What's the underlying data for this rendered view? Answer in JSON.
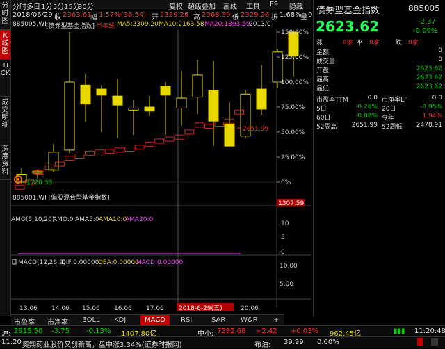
{
  "side_nav": [
    "分时图",
    "K线图",
    "TICK",
    "成交明细",
    "深度资料"
  ],
  "top_menu": [
    "分时",
    "多日",
    "1分",
    "5分",
    "15分",
    "30分",
    "复权",
    "超级叠加",
    "画线",
    "工具",
    "F9",
    "隐藏"
  ],
  "info_bar": {
    "date": "2018/06/29",
    "close_label": "收",
    "close": "2363.61",
    "pct_label": "幅",
    "pct": "1.57%(36.54)",
    "open_label": "开",
    "open": "2329.26",
    "high_label": "高",
    "high": "2368.30",
    "low_label": "低",
    "low": "2329.26",
    "amp_label": "振",
    "amp": "1.68%",
    "vol_label": "量",
    "vol": "0"
  },
  "ma_bar": {
    "code": "885005.WI",
    "name": "[债券型基金指数]",
    "half_year": "半年线",
    "ma5": "MA5:2309.20",
    "ma10": "MA10:2163.58",
    "ma20": "MA20:1893.59",
    "date": "2013/0"
  },
  "price_axis": [
    "150.00%",
    "125.00%",
    "100.00%",
    "75.00%",
    "50.00%",
    "25.00%",
    "0%"
  ],
  "overlay": {
    "label": "885001.WI [偏股混合型基金指数]",
    "base_value": "1720.33",
    "peak_value": "2651.99",
    "right_value": "1307.59"
  },
  "amo_bar": {
    "title": "AMO(5,10,20)",
    "amo": "AMO:0",
    "amo5": "AMA5:0",
    "amo10": "AMA10:0",
    "amo20": "AMA20:0"
  },
  "amo_axis": [
    "10",
    "5",
    "0"
  ],
  "macd_bar": {
    "title": "MACD(12,26,9)",
    "dif": "DIF:0.00000",
    "dea": "DEA:0.00000",
    "macd": "MACD:0.00000"
  },
  "macd_axis": [
    "10.00",
    "5.00"
  ],
  "date_axis": [
    "13.06",
    "14.06",
    "15.06",
    "16.06",
    "17.06",
    "2018-6-29(五)",
    "20.06"
  ],
  "bottom_tabs": [
    "市盈率",
    "市净率",
    "BOLL",
    "KDJ",
    "MACD",
    "RSI",
    "SAR",
    "W&R",
    "+"
  ],
  "right_panel": {
    "title": "债券型基金指数",
    "code": "885005",
    "price": "2623.62",
    "change": "-2.37",
    "change_pct": "-0.09%",
    "breadth": [
      {
        "label": "涨",
        "value": "0家"
      },
      {
        "label": "平",
        "value": "0家"
      },
      {
        "label": "跌",
        "value": "0家"
      }
    ],
    "metrics": [
      {
        "label": "金额",
        "value": "0"
      },
      {
        "label": "成交量",
        "value": "0"
      },
      {
        "label": "开盘",
        "value": "2623.62"
      },
      {
        "label": "最高",
        "value": "2623.62"
      },
      {
        "label": "最低",
        "value": "2623.62"
      }
    ],
    "ratios": [
      {
        "l1": "市盈率TTM",
        "v1": "0.0",
        "l2": "市净率LF",
        "v2": "0.0"
      },
      {
        "l1": "5日",
        "v1": "-0.26%",
        "l2": "20日",
        "v2": "-0.95%"
      },
      {
        "l1": "60日",
        "v1": "-0.08%",
        "l2": "今年",
        "v2": "1.94%"
      },
      {
        "l1": "52周高",
        "v1": "2651.99",
        "l2": "52周低",
        "v2": "2478.91"
      }
    ]
  },
  "status_bar": {
    "index1_label": "沪:",
    "index1_value": "2915.50",
    "index1_change": "-3.75",
    "index1_pct": "-0.13%",
    "index1_amount": "1407.80亿",
    "index2_label": "中小:",
    "index2_value": "7292.68",
    "index2_change": "+2.42",
    "index2_pct": "+0.03%",
    "index2_amount": "962.45亿",
    "time": "11:20:48"
  },
  "ticker": {
    "time": "11:20",
    "text": "奥翔药业股价又创新高，盘中涨3.34%(证券时报网)",
    "right_label": "布油:",
    "right_value": "39.99",
    "right_pct": "0.00%"
  },
  "chart_data": {
    "type": "candlestick",
    "candles_pct": [
      {
        "open": 0,
        "close": 8,
        "high": 14,
        "low": -2
      },
      {
        "open": 9,
        "close": 11,
        "high": 12,
        "low": 3
      },
      {
        "open": 12,
        "close": 30,
        "high": 38,
        "low": 10
      },
      {
        "open": 32,
        "close": 100,
        "high": 150,
        "low": 29
      },
      {
        "open": 97,
        "close": 78,
        "high": 108,
        "low": 60
      },
      {
        "open": 93,
        "close": 87,
        "high": 97,
        "low": 50
      },
      {
        "open": 86,
        "close": 77,
        "high": 103,
        "low": 44
      },
      {
        "open": 72,
        "close": 74,
        "high": 82,
        "low": 47
      },
      {
        "open": 75,
        "close": 71,
        "high": 86,
        "low": 66
      },
      {
        "open": 96,
        "close": 87,
        "high": 100,
        "low": 47
      },
      {
        "open": 74,
        "close": 84,
        "high": 111,
        "low": 56
      },
      {
        "open": 85,
        "close": 107,
        "high": 122,
        "low": 68
      },
      {
        "open": 92,
        "close": 61,
        "high": 121,
        "low": 36
      },
      {
        "open": 58,
        "close": 36,
        "high": 80,
        "low": 46
      },
      {
        "open": 46,
        "close": 88,
        "high": 92,
        "low": 44
      },
      {
        "open": 93,
        "close": 73,
        "high": 117,
        "low": 67
      },
      {
        "open": 100,
        "close": 130,
        "high": 133,
        "low": 94
      },
      {
        "open": 150,
        "close": 126,
        "high": 152,
        "low": 105
      }
    ],
    "overlay_pct": [
      -5,
      0,
      10,
      15,
      18,
      24,
      26,
      29,
      30,
      31,
      32,
      33,
      35,
      38,
      41,
      43,
      45,
      50,
      57,
      56,
      58,
      61,
      70
    ],
    "y_axis": {
      "min": 0,
      "max": 150,
      "unit": "%"
    }
  },
  "colors": {
    "up": "#ff3232",
    "down": "#00d800",
    "bull": "#e8d800",
    "accent": "#c00000"
  }
}
